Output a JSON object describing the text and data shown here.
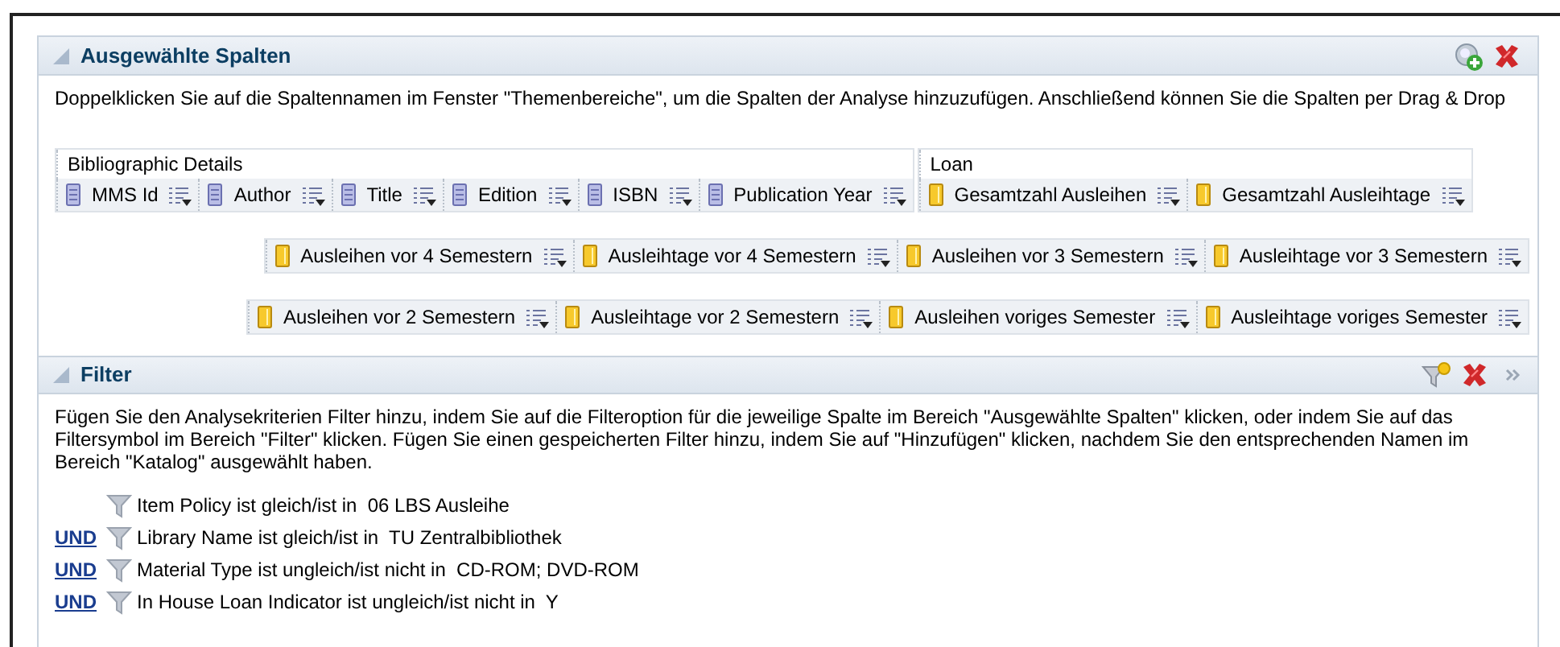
{
  "selected_columns": {
    "title": "Ausgewählte Spalten",
    "expanded": true,
    "description": "Doppelklicken Sie auf die Spaltennamen im Fenster \"Themenbereiche\", um die Spalten der Analyse hinzuzufügen. Anschließend können Sie die Spalten per Drag & Drop",
    "groups": [
      {
        "label": "Bibliographic Details",
        "columns": [
          {
            "label": "MMS Id",
            "kind": "attribute"
          },
          {
            "label": "Author",
            "kind": "attribute"
          },
          {
            "label": "Title",
            "kind": "attribute"
          },
          {
            "label": "Edition",
            "kind": "attribute"
          },
          {
            "label": "ISBN",
            "kind": "attribute"
          },
          {
            "label": "Publication Year",
            "kind": "attribute"
          }
        ]
      },
      {
        "label": "Loan",
        "columns": [
          {
            "label": "Gesamtzahl Ausleihen",
            "kind": "measure"
          },
          {
            "label": "Gesamtzahl Ausleihtage",
            "kind": "measure"
          }
        ]
      }
    ],
    "wrapped_rows": [
      [
        {
          "label": "Ausleihen vor 4 Semestern",
          "kind": "measure"
        },
        {
          "label": "Ausleihtage vor 4 Semestern",
          "kind": "measure"
        },
        {
          "label": "Ausleihen vor 3 Semestern",
          "kind": "measure"
        },
        {
          "label": "Ausleihtage vor 3 Semestern",
          "kind": "measure"
        }
      ],
      [
        {
          "label": "Ausleihen vor 2 Semestern",
          "kind": "measure"
        },
        {
          "label": "Ausleihtage vor 2 Semestern",
          "kind": "measure"
        },
        {
          "label": "Ausleihen voriges Semester",
          "kind": "measure"
        },
        {
          "label": "Ausleihtage voriges Semester",
          "kind": "measure"
        }
      ]
    ]
  },
  "filter": {
    "title": "Filter",
    "expanded": true,
    "description": "Fügen Sie den Analysekriterien Filter hinzu, indem Sie auf die Filteroption für die jeweilige Spalte im Bereich \"Ausgewählte Spalten\" klicken, oder indem Sie auf das Filtersymbol im Bereich \"Filter\" klicken. Fügen Sie einen gespeicherten Filter hinzu, indem Sie auf \"Hinzufügen\" klicken, nachdem Sie den entsprechenden Namen im Bereich \"Katalog\" ausgewählt haben.",
    "conditions": [
      {
        "text": "Item Policy ist gleich/ist in  06 LBS Ausleihe"
      },
      {
        "conjunction": "UND",
        "text": "Library Name ist gleich/ist in  TU Zentralbibliothek"
      },
      {
        "conjunction": "UND",
        "text": "Material Type ist ungleich/ist nicht in  CD-ROM; DVD-ROM"
      },
      {
        "conjunction": "UND",
        "text": "In House Loan Indicator ist ungleich/ist nicht in  Y"
      }
    ]
  }
}
